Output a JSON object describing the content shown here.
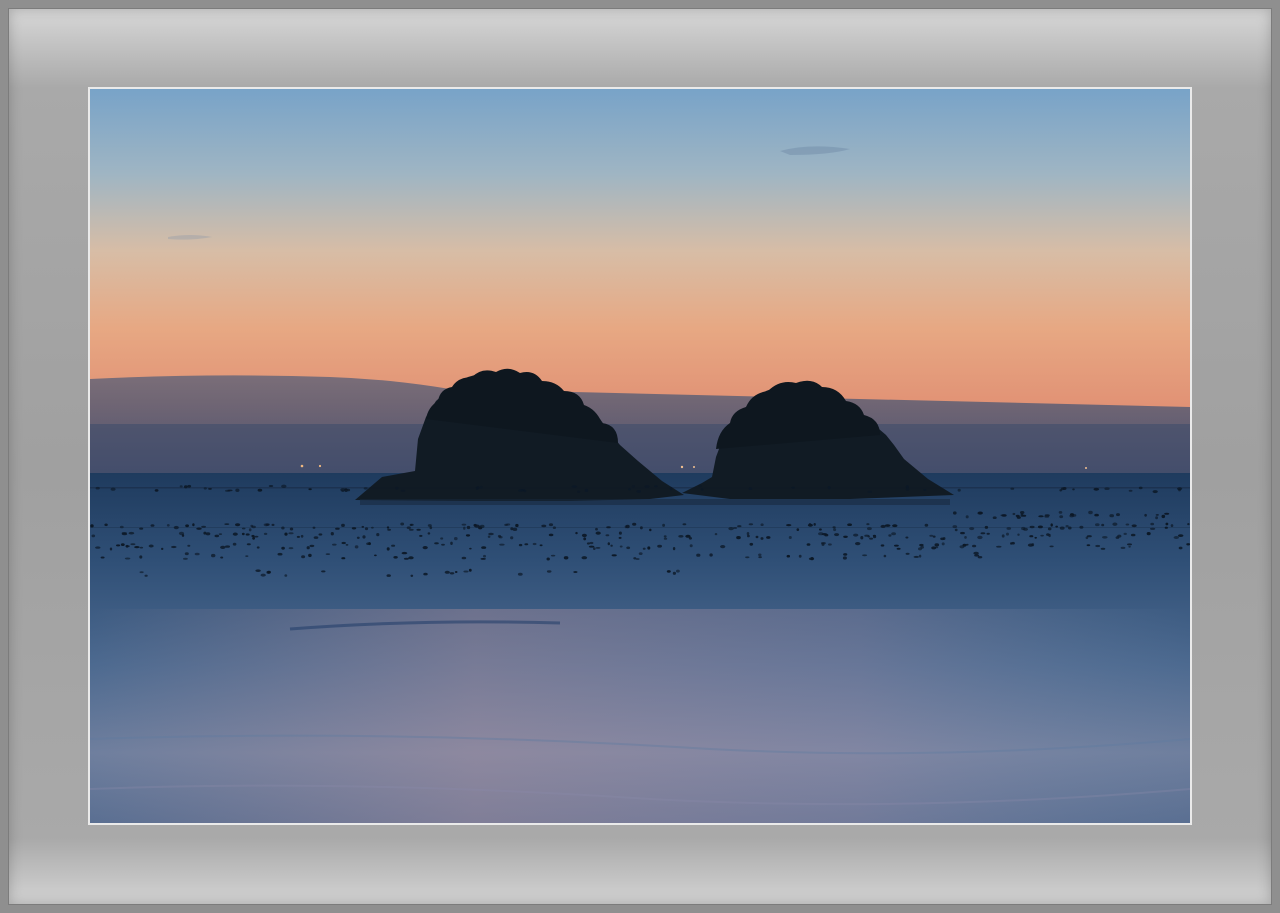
{
  "page": {
    "type": "framed-photograph"
  },
  "frame": {
    "color_outer": "#8f8f8f",
    "color_mat_light": "#d8d8d8",
    "color_mat_mid": "#a0a0a0",
    "inner_border": "#eaeaea"
  },
  "photo": {
    "subject": "two-island-silhouettes-at-dusk",
    "colors": {
      "sky_top": "#7ea6c8",
      "sky_middle": "#e8c0a0",
      "sky_horizon": "#e59a76",
      "haze_band": "#4a5876",
      "sea": "#33557c",
      "island": "#101a22"
    }
  }
}
